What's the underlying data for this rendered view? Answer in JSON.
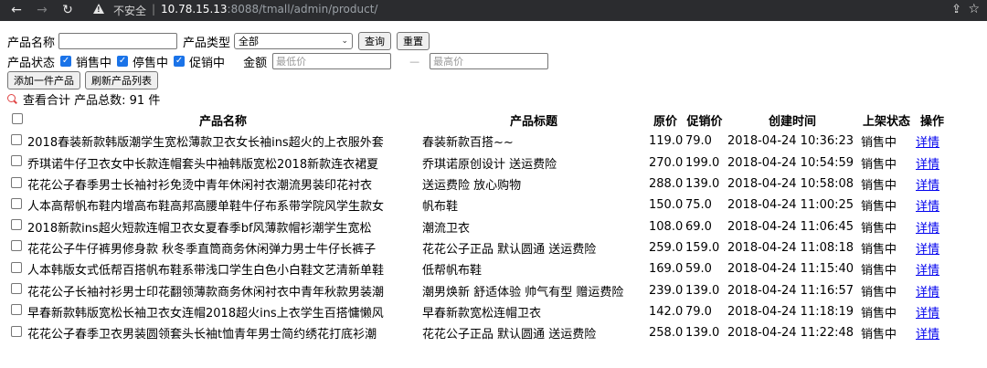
{
  "browser": {
    "insecure_label": "不安全",
    "url_host": "10.78.15.13",
    "url_path": ":8088/tmall/admin/product/"
  },
  "filters": {
    "name_label": "产品名称",
    "name_value": "",
    "type_label": "产品类型",
    "type_selected": "全部",
    "query_button": "查询",
    "reset_button": "重置",
    "status_label": "产品状态",
    "status_options": [
      {
        "label": "销售中",
        "checked": true
      },
      {
        "label": "停售中",
        "checked": true
      },
      {
        "label": "促销中",
        "checked": true
      }
    ],
    "amount_label": "金额",
    "min_price_placeholder": "最低价",
    "price_dash": "—",
    "max_price_placeholder": "最高价"
  },
  "actions": {
    "add_button": "添加一件产品",
    "refresh_button": "刷新产品列表"
  },
  "summary": {
    "text": "查看合计 产品总数: 91 件"
  },
  "table": {
    "headers": {
      "name": "产品名称",
      "title": "产品标题",
      "price": "原价",
      "promo": "促销价",
      "created": "创建时间",
      "status": "上架状态",
      "op": "操作"
    },
    "rows": [
      {
        "name": "2018春装新款韩版潮学生宽松薄款卫衣女长袖ins超火的上衣服外套",
        "title": "春装新款百搭~~",
        "price": "119.0",
        "promo": "79.0",
        "created": "2018-04-24 10:36:23",
        "status": "销售中",
        "op": "详情"
      },
      {
        "name": "乔琪诺牛仔卫衣女中长款连帽套头中袖韩版宽松2018新款连衣裙夏",
        "title": "乔琪诺原创设计 送运费险",
        "price": "270.0",
        "promo": "199.0",
        "created": "2018-04-24 10:54:59",
        "status": "销售中",
        "op": "详情"
      },
      {
        "name": "花花公子春季男士长袖衬衫免烫中青年休闲衬衣潮流男装印花衬衣",
        "title": "送运费险 放心购物",
        "price": "288.0",
        "promo": "139.0",
        "created": "2018-04-24 10:58:08",
        "status": "销售中",
        "op": "详情"
      },
      {
        "name": "人本高帮帆布鞋内增高布鞋高邦高腰单鞋牛仔布系带学院风学生款女",
        "title": "帆布鞋",
        "price": "150.0",
        "promo": "75.0",
        "created": "2018-04-24 11:00:25",
        "status": "销售中",
        "op": "详情"
      },
      {
        "name": "2018新款ins超火短款连帽卫衣女夏春季bf风薄款帽衫潮学生宽松",
        "title": "潮流卫衣",
        "price": "108.0",
        "promo": "69.0",
        "created": "2018-04-24 11:06:45",
        "status": "销售中",
        "op": "详情"
      },
      {
        "name": "花花公子牛仔裤男修身款 秋冬季直筒商务休闲弹力男士牛仔长裤子",
        "title": "花花公子正品 默认圆通 送运费险",
        "price": "259.0",
        "promo": "159.0",
        "created": "2018-04-24 11:08:18",
        "status": "销售中",
        "op": "详情"
      },
      {
        "name": "人本韩版女式低帮百搭帆布鞋系带浅口学生白色小白鞋文艺清新单鞋",
        "title": "低帮帆布鞋",
        "price": "169.0",
        "promo": "59.0",
        "created": "2018-04-24 11:15:40",
        "status": "销售中",
        "op": "详情"
      },
      {
        "name": "花花公子长袖衬衫男士印花翻领薄款商务休闲衬衣中青年秋款男装潮",
        "title": "潮男焕新 舒适体验 帅气有型 赠运费险",
        "price": "239.0",
        "promo": "139.0",
        "created": "2018-04-24 11:16:57",
        "status": "销售中",
        "op": "详情"
      },
      {
        "name": "早春新款韩版宽松长袖卫衣女连帽2018超火ins上衣学生百搭慵懒风",
        "title": "早春新款宽松连帽卫衣",
        "price": "142.0",
        "promo": "79.0",
        "created": "2018-04-24 11:18:19",
        "status": "销售中",
        "op": "详情"
      },
      {
        "name": "花花公子春季卫衣男装圆领套头长袖t恤青年男士简约绣花打底衫潮",
        "title": "花花公子正品 默认圆通 送运费险",
        "price": "258.0",
        "promo": "139.0",
        "created": "2018-04-24 11:22:48",
        "status": "销售中",
        "op": "详情"
      }
    ]
  },
  "icons": {
    "back": "←",
    "forward": "→",
    "reload": "↻",
    "check": "✓",
    "chevron": "⌄",
    "share": "⇪",
    "star": "☆"
  }
}
